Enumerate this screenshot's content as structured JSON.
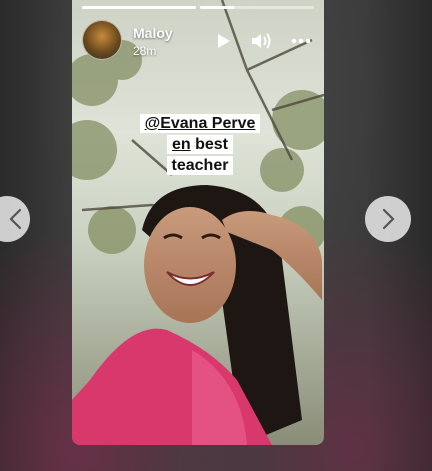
{
  "story": {
    "progress": [
      1.0,
      0.3
    ],
    "user": {
      "name": "Maloy",
      "time": "28m"
    },
    "icons": {
      "avatar": "user-avatar",
      "play": "play-icon",
      "sound": "speaker-icon",
      "more": "more-icon"
    },
    "caption": {
      "mention_part1": "@Evana Perve",
      "mention_part2": "en",
      "after": " best",
      "line3": "teacher"
    }
  },
  "nav": {
    "prev": "chevron-left-icon",
    "next": "chevron-right-icon"
  },
  "colors": {
    "accent_pink": "#d9386c",
    "overlay_text": "#ffffff"
  }
}
